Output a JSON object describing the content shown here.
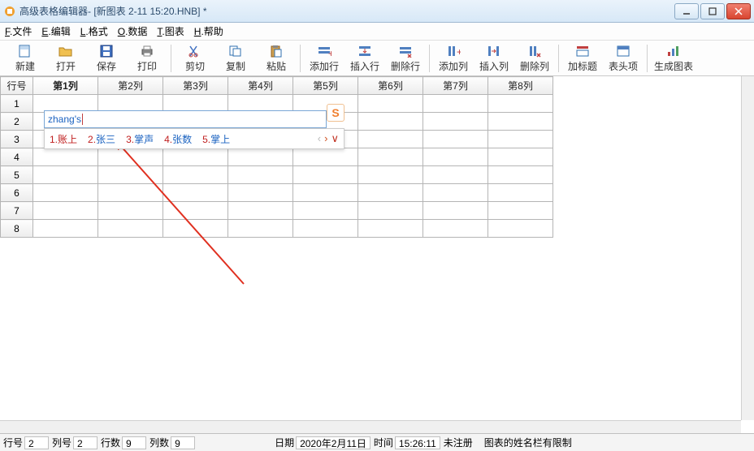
{
  "window": {
    "title": "高级表格编辑器- [新图表 2-11 15:20.HNB] *"
  },
  "menu": {
    "file_u": "F",
    "file": ".文件",
    "edit_u": "E",
    "edit": ".编辑",
    "format_u": "L",
    "format": ".格式",
    "data_u": "O",
    "data": ".数据",
    "chart_u": "T",
    "chart": ".图表",
    "help_u": "H",
    "help": ".帮助"
  },
  "toolbar": {
    "new": "新建",
    "open": "打开",
    "save": "保存",
    "print": "打印",
    "cut": "剪切",
    "copy": "复制",
    "paste": "粘贴",
    "addrow": "添加行",
    "insrow": "插入行",
    "delrow": "删除行",
    "addcol": "添加列",
    "inscol": "插入列",
    "delcol": "删除列",
    "addtitle": "加标题",
    "header": "表头项",
    "genchart": "生成图表"
  },
  "grid": {
    "rowhdr": "行号",
    "cols": [
      "第1列",
      "第2列",
      "第3列",
      "第4列",
      "第5列",
      "第6列",
      "第7列",
      "第8列"
    ],
    "rows": [
      1,
      2,
      3,
      4,
      5,
      6,
      7,
      8
    ]
  },
  "ime": {
    "input": "zhang's",
    "logo": "S",
    "cands": [
      {
        "n": "1.",
        "t": "账上"
      },
      {
        "n": "2.",
        "t": "张三"
      },
      {
        "n": "3.",
        "t": "掌声"
      },
      {
        "n": "4.",
        "t": "张数"
      },
      {
        "n": "5.",
        "t": "掌上"
      }
    ],
    "prev": "‹",
    "next": "›",
    "expand": "∨"
  },
  "status": {
    "row_l": "行号",
    "row_v": "2",
    "col_l": "列号",
    "col_v": "2",
    "rows_l": "行数",
    "rows_v": "9",
    "cols_l": "列数",
    "cols_v": "9",
    "date_l": "日期",
    "date_v": "2020年2月11日",
    "time_l": "时间",
    "time_v": "15:26:11",
    "reg": "未注册",
    "tail": "图表的姓名栏有限制"
  }
}
